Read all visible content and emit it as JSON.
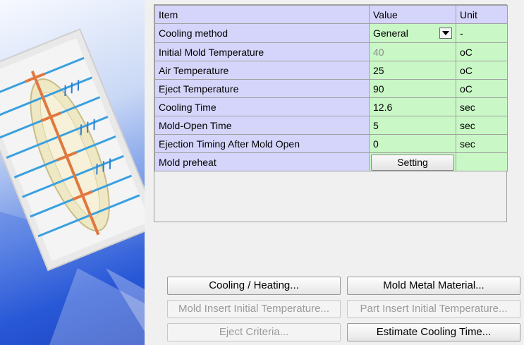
{
  "grid": {
    "headers": {
      "item": "Item",
      "value": "Value",
      "unit": "Unit"
    },
    "rows": [
      {
        "item": "Cooling method",
        "value": "General",
        "unit": "-"
      },
      {
        "item": "Initial Mold Temperature",
        "value": "40",
        "unit": "oC"
      },
      {
        "item": "Air Temperature",
        "value": "25",
        "unit": "oC"
      },
      {
        "item": "Eject Temperature",
        "value": "90",
        "unit": "oC"
      },
      {
        "item": "Cooling Time",
        "value": "12.6",
        "unit": "sec"
      },
      {
        "item": "Mold-Open Time",
        "value": "5",
        "unit": "sec"
      },
      {
        "item": "Ejection Timing After Mold Open",
        "value": "0",
        "unit": "sec"
      },
      {
        "item": "Mold preheat",
        "value": "Setting",
        "unit": ""
      }
    ]
  },
  "buttons": {
    "cooling_heating": "Cooling / Heating...",
    "mold_metal_material": "Mold Metal Material...",
    "mold_insert_initial_temp": "Mold Insert Initial Temperature...",
    "part_insert_initial_temp": "Part Insert Initial Temperature...",
    "eject_criteria": "Eject Criteria...",
    "estimate_cooling_time": "Estimate Cooling Time..."
  },
  "colors": {
    "header_bg": "#d5d5fb",
    "item_bg": "#d5d5fb",
    "value_bg": "#c9f8c6",
    "disabled_text": "#8a8a8a"
  },
  "icons": {
    "dropdown": "chevron-down-icon",
    "illustration": "mold-cooling-illustration"
  }
}
